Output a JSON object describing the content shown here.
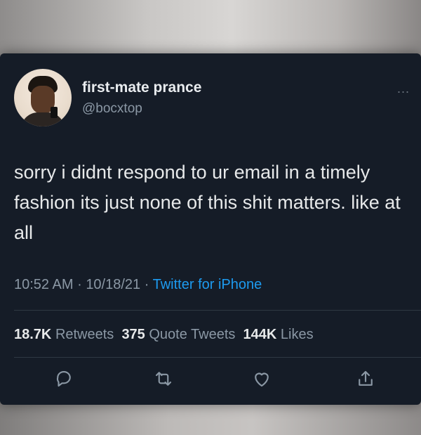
{
  "tweet": {
    "display_name": "first-mate prance",
    "handle": "@bocxtop",
    "more_label": "...",
    "text": "sorry i didnt respond to ur email in a timely fashion its just none of this shit matters. like at all",
    "time": "10:52 AM",
    "date": "10/18/21",
    "source": "Twitter for iPhone",
    "separator": "·"
  },
  "stats": {
    "retweets_count": "18.7K",
    "retweets_label": "Retweets",
    "quotes_count": "375",
    "quotes_label": "Quote Tweets",
    "likes_count": "144K",
    "likes_label": "Likes"
  },
  "icons": {
    "reply": "reply-icon",
    "retweet": "retweet-icon",
    "like": "like-icon",
    "share": "share-icon"
  },
  "colors": {
    "card_bg": "#151c27",
    "primary_text": "#e7e9ea",
    "secondary_text": "#8b98a5",
    "link_blue": "#1d9bf0"
  }
}
